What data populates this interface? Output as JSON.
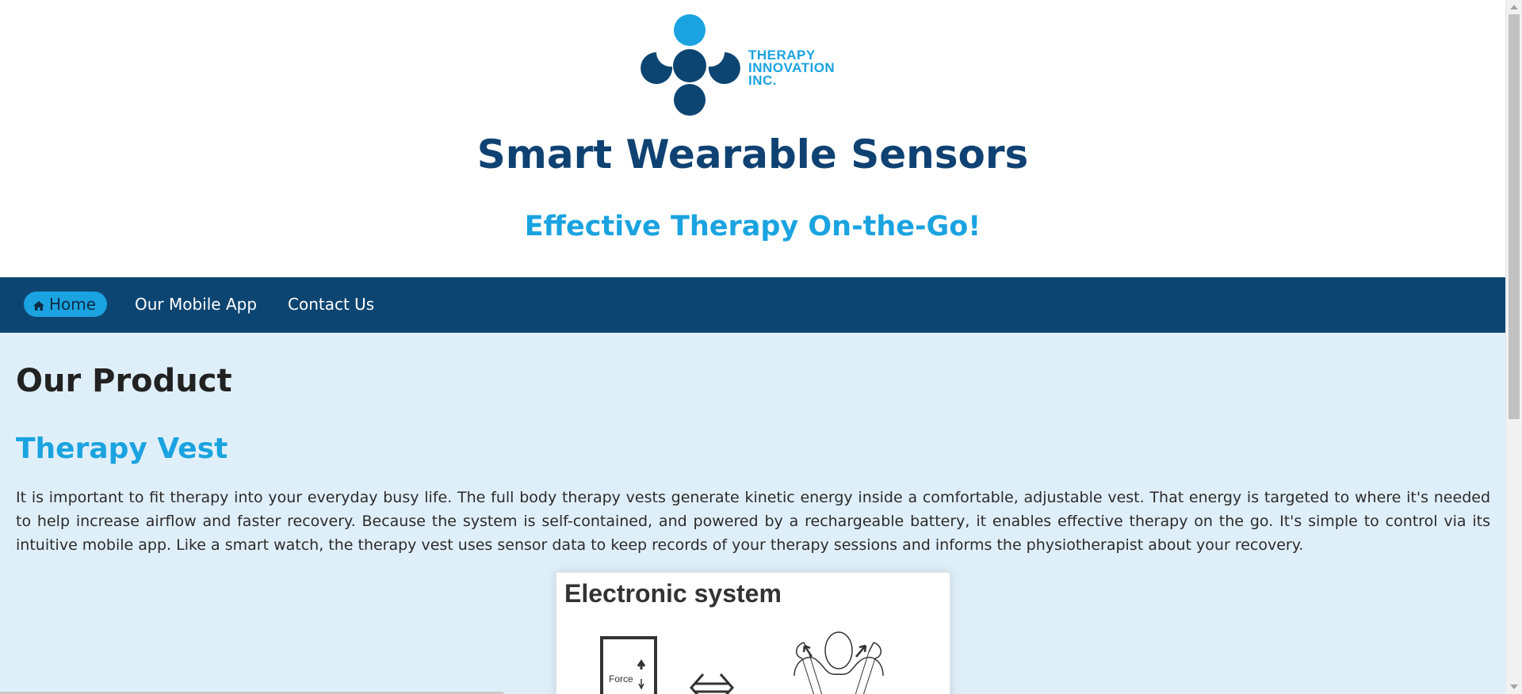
{
  "header": {
    "logo": {
      "icon": "therapy-innovation-logo",
      "lines": [
        "THERAPY",
        "INNOVATION",
        "INC."
      ]
    },
    "title": "Smart Wearable Sensors",
    "tagline": "Effective Therapy On-the-Go!"
  },
  "nav": {
    "items": [
      {
        "label": "Home",
        "icon": "home-icon",
        "active": true
      },
      {
        "label": "Our Mobile App",
        "active": false
      },
      {
        "label": "Contact Us",
        "active": false
      }
    ]
  },
  "main": {
    "heading": "Our Product",
    "subheading": "Therapy Vest",
    "paragraph": "It is important to fit therapy into your everyday busy life. The full body therapy vests generate kinetic energy inside a comfortable, adjustable vest. That energy is targeted to where it's needed to help increase airflow and faster recovery. Because the system is self-contained, and powered by a rechargeable battery, it enables effective therapy on the go. It's simple to control via its intuitive mobile app. Like a smart watch, the therapy vest uses sensor data to keep records of your therapy sessions and informs the physiotherapist about your recovery.",
    "figure": {
      "title": "Electronic system",
      "device_label": "Force"
    }
  },
  "colors": {
    "brand_dark": "#0d4572",
    "brand_light": "#1aa3e0",
    "content_bg": "#dfeffa"
  }
}
